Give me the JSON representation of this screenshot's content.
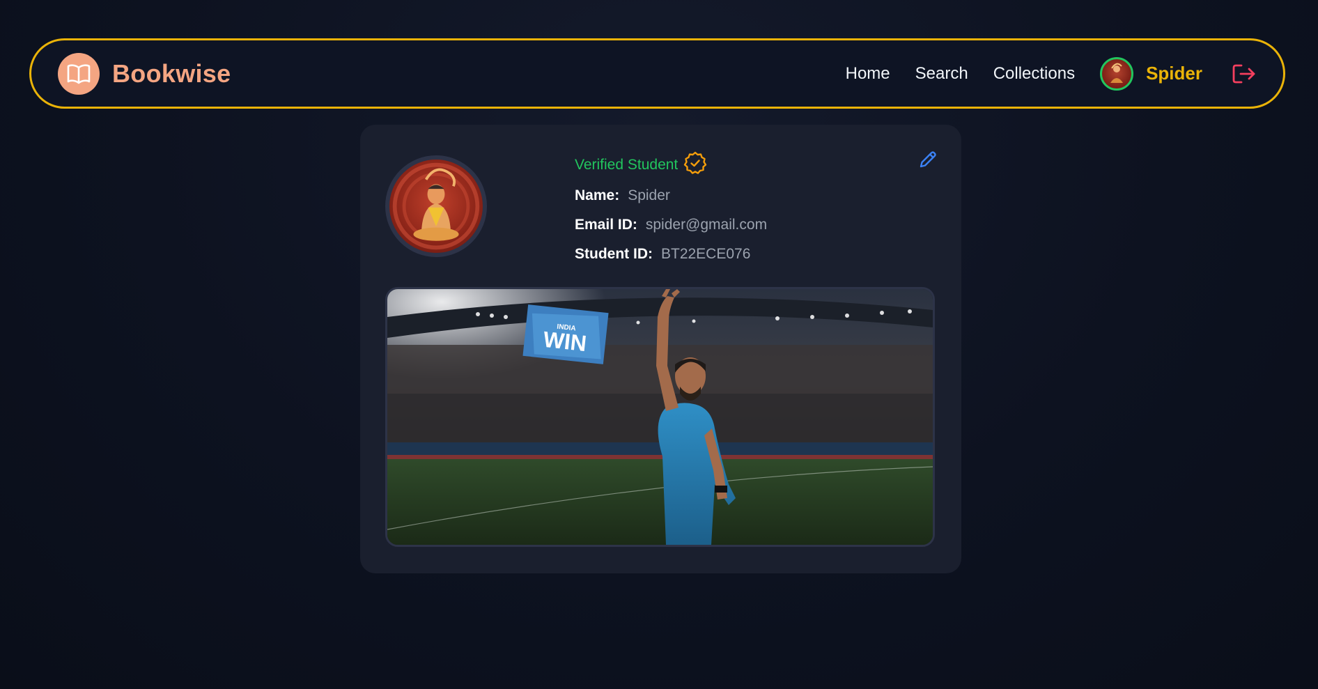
{
  "navbar": {
    "brand_name": "Bookwise",
    "links": [
      {
        "label": "Home"
      },
      {
        "label": "Search"
      },
      {
        "label": "Collections"
      }
    ],
    "username": "Spider"
  },
  "profile": {
    "verified_label": "Verified Student",
    "fields": [
      {
        "label": "Name:",
        "value": "Spider"
      },
      {
        "label": "Email ID:",
        "value": "spider@gmail.com"
      },
      {
        "label": "Student ID:",
        "value": "BT22ECE076"
      }
    ],
    "banner_sign_small": "INDIA",
    "banner_sign_big": "WIN"
  },
  "colors": {
    "accent_border": "#eab308",
    "brand": "#f4a582",
    "verified": "#22c55e",
    "logout": "#f43f5e",
    "edit": "#3b82f6"
  },
  "icons": {
    "brand": "open-book-icon",
    "verified": "verified-badge-icon",
    "edit": "pencil-icon",
    "logout": "logout-icon"
  }
}
